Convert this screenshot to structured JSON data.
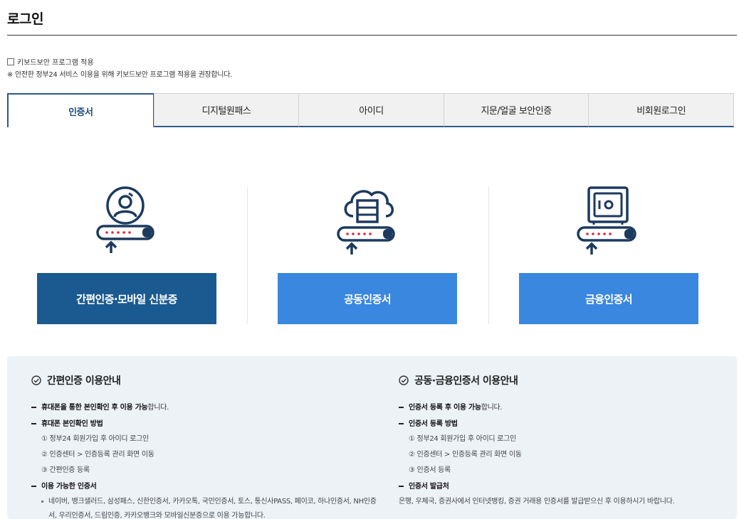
{
  "page": {
    "title": "로그인"
  },
  "keyboard_security": {
    "checkbox_label": "키보드보안 프로그램 적용",
    "note": "※ 안전한 정부24 서비스 이용을 위해 키보드보안 프로그램 적용을 권장합니다."
  },
  "tabs": [
    {
      "label": "인증서",
      "active": true
    },
    {
      "label": "디지털원패스",
      "active": false
    },
    {
      "label": "아이디",
      "active": false
    },
    {
      "label": "지문/얼굴 보안인증",
      "active": false
    },
    {
      "label": "비회원로그인",
      "active": false
    }
  ],
  "cert_options": [
    {
      "label": "간편인증·모바일 신분증",
      "icon": "person-id-icon",
      "color": "#1b5a91"
    },
    {
      "label": "공동인증서",
      "icon": "cloud-server-icon",
      "color": "#3a87e0"
    },
    {
      "label": "금융인증서",
      "icon": "safe-icon",
      "color": "#3a87e0"
    }
  ],
  "guide": {
    "simple": {
      "title": "간편인증 이용안내",
      "item1_bold": "휴대폰을 통한 본인확인 후 이용 가능",
      "item1_rest": "합니다.",
      "item2_bold": "휴대폰 본인확인 방법",
      "step1": "① 정부24 회원가입 후 아이디 로그인",
      "step2": "② 인증센터 > 인증등록 관리 화면 이동",
      "step3": "③ 간편인증 등록",
      "item3_bold": "이용 가능한 인증서",
      "available_line1": "네이버, 뱅크샐러드, 삼성패스, 신한인증서, 카카오톡, 국민인증서, 토스, 통신사PASS, 페이코, 하나인증서, NH인증",
      "available_line2": "서, 우리인증서, 드림인증, 카카오뱅크와 모바일신분증으로 이용 가능합니다."
    },
    "joint": {
      "title": "공동·금융인증서 이용안내",
      "item1_bold": "인증서 등록 후 이용 가능",
      "item1_rest": "합니다.",
      "item2_bold": "인증서 등록 방법",
      "step1": "① 정부24 회원가입 후 아이디 로그인",
      "step2": "② 인증센터 > 인증등록 관리 화면 이동",
      "step3": "③ 인증서 등록",
      "item3_bold": "인증서 발급처",
      "issuer_text": "은행, 우체국, 증권사에서 인터넷뱅킹, 증권 거래용 인증서를 발급받으신 후 이용하시기 바랍니다."
    }
  },
  "colors": {
    "accent": "#2b5a8c",
    "icon_navy": "#1c3a5e",
    "icon_red": "#e0283a",
    "guide_bg": "#edf2f7"
  }
}
